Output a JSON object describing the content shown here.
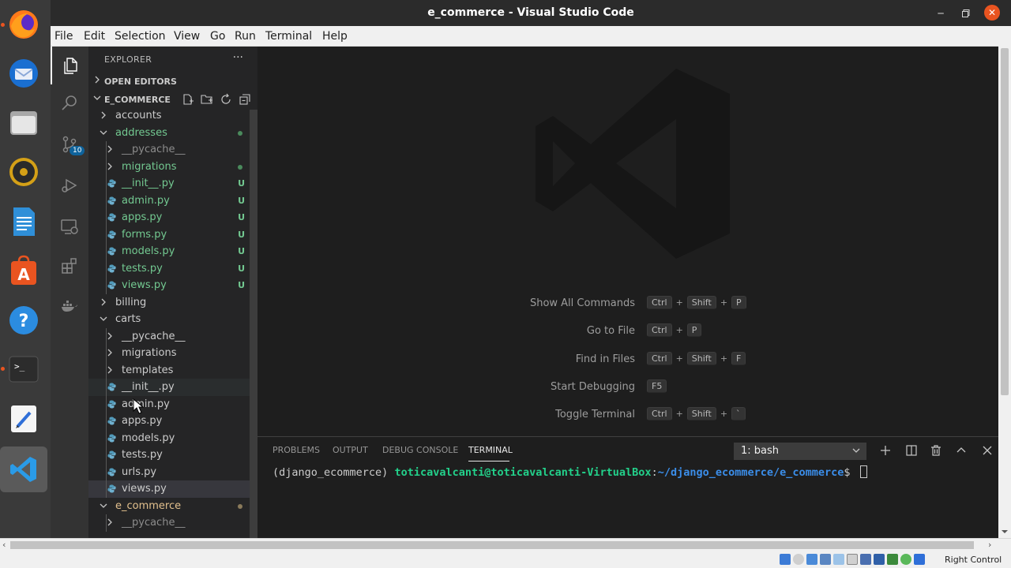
{
  "window": {
    "title": "e_commerce - Visual Studio Code"
  },
  "menubar": [
    "File",
    "Edit",
    "Selection",
    "View",
    "Go",
    "Run",
    "Terminal",
    "Help"
  ],
  "activitybar": {
    "source_control_badge": "10"
  },
  "explorer": {
    "header": "EXPLORER",
    "more": "···",
    "open_editors": "OPEN EDITORS",
    "workspace": "E_COMMERCE",
    "tree": [
      {
        "name": "accounts",
        "type": "folder",
        "open": false,
        "depth": 0,
        "status": "",
        "color": "#cccccc"
      },
      {
        "name": "addresses",
        "type": "folder",
        "open": true,
        "depth": 0,
        "status": "dot",
        "color": "#73c991"
      },
      {
        "name": "__pycache__",
        "type": "folder",
        "open": false,
        "depth": 1,
        "status": "",
        "color": "#8c8c8c"
      },
      {
        "name": "migrations",
        "type": "folder",
        "open": false,
        "depth": 1,
        "status": "dot",
        "color": "#73c991"
      },
      {
        "name": "__init__.py",
        "type": "py",
        "depth": 1,
        "status": "U",
        "color": "#73c991"
      },
      {
        "name": "admin.py",
        "type": "py",
        "depth": 1,
        "status": "U",
        "color": "#73c991"
      },
      {
        "name": "apps.py",
        "type": "py",
        "depth": 1,
        "status": "U",
        "color": "#73c991"
      },
      {
        "name": "forms.py",
        "type": "py",
        "depth": 1,
        "status": "U",
        "color": "#73c991"
      },
      {
        "name": "models.py",
        "type": "py",
        "depth": 1,
        "status": "U",
        "color": "#73c991"
      },
      {
        "name": "tests.py",
        "type": "py",
        "depth": 1,
        "status": "U",
        "color": "#73c991"
      },
      {
        "name": "views.py",
        "type": "py",
        "depth": 1,
        "status": "U",
        "color": "#73c991"
      },
      {
        "name": "billing",
        "type": "folder",
        "open": false,
        "depth": 0,
        "status": "",
        "color": "#cccccc"
      },
      {
        "name": "carts",
        "type": "folder",
        "open": true,
        "depth": 0,
        "status": "",
        "color": "#cccccc"
      },
      {
        "name": "__pycache__",
        "type": "folder",
        "open": false,
        "depth": 1,
        "status": "",
        "color": "#cccccc"
      },
      {
        "name": "migrations",
        "type": "folder",
        "open": false,
        "depth": 1,
        "status": "",
        "color": "#cccccc"
      },
      {
        "name": "templates",
        "type": "folder",
        "open": false,
        "depth": 1,
        "status": "",
        "color": "#cccccc"
      },
      {
        "name": "__init__.py",
        "type": "py",
        "depth": 1,
        "status": "",
        "color": "#cccccc",
        "hover": true
      },
      {
        "name": "admin.py",
        "type": "py",
        "depth": 1,
        "status": "",
        "color": "#cccccc"
      },
      {
        "name": "apps.py",
        "type": "py",
        "depth": 1,
        "status": "",
        "color": "#cccccc"
      },
      {
        "name": "models.py",
        "type": "py",
        "depth": 1,
        "status": "",
        "color": "#cccccc"
      },
      {
        "name": "tests.py",
        "type": "py",
        "depth": 1,
        "status": "",
        "color": "#cccccc"
      },
      {
        "name": "urls.py",
        "type": "py",
        "depth": 1,
        "status": "",
        "color": "#cccccc"
      },
      {
        "name": "views.py",
        "type": "py",
        "depth": 1,
        "status": "",
        "color": "#cccccc",
        "selected": true
      },
      {
        "name": "e_commerce",
        "type": "folder",
        "open": true,
        "depth": 0,
        "status": "dot-modified",
        "color": "#e2c08d"
      },
      {
        "name": "__pycache__",
        "type": "folder",
        "open": false,
        "depth": 1,
        "status": "",
        "color": "#8c8c8c"
      }
    ]
  },
  "shortcuts": [
    {
      "label": "Show All Commands",
      "keys": [
        "Ctrl",
        "Shift",
        "P"
      ]
    },
    {
      "label": "Go to File",
      "keys": [
        "Ctrl",
        "P"
      ]
    },
    {
      "label": "Find in Files",
      "keys": [
        "Ctrl",
        "Shift",
        "F"
      ]
    },
    {
      "label": "Start Debugging",
      "keys": [
        "F5"
      ]
    },
    {
      "label": "Toggle Terminal",
      "keys": [
        "Ctrl",
        "Shift",
        "`"
      ]
    }
  ],
  "panel": {
    "tabs": [
      "PROBLEMS",
      "OUTPUT",
      "DEBUG CONSOLE",
      "TERMINAL"
    ],
    "active_tab": "TERMINAL",
    "terminal_select": "1: bash",
    "prompt_env": "(django_ecommerce)",
    "prompt_user": "toticavalcanti@toticavalcanti-VirtualBox",
    "prompt_sep": ":",
    "prompt_path": "~/django_ecommerce/e_commerce",
    "prompt_end": "$"
  },
  "vbox": {
    "host_key_label": "Right Control"
  },
  "colors": {
    "accent_orange": "#e95420",
    "git_untracked": "#73c991",
    "git_modified": "#e2c08d",
    "terminal_green": "#23d18b",
    "terminal_blue": "#3b8eea"
  }
}
